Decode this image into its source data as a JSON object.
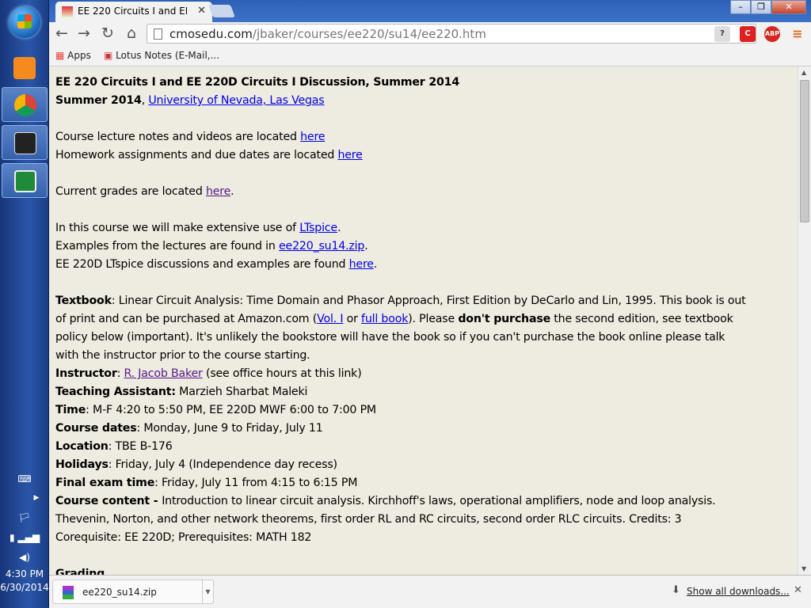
{
  "taskbar": {
    "time": "4:30 PM",
    "date": "6/30/2014"
  },
  "tab": {
    "title": "EE 220 Circuits I and EE 220D Circuits I Discussion, Summer 2014"
  },
  "toolbar": {
    "url_host": "cmosedu.com",
    "url_path": "/jbaker/courses/ee220/su14/ee220.htm",
    "ext_abp": "ABP"
  },
  "bookmarks": [
    {
      "label": "Apps"
    },
    {
      "label": "Lotus Notes (E-Mail,..."
    }
  ],
  "page": {
    "title": "EE 220 Circuits I and EE 220D Circuits I Discussion, Summer 2014",
    "term": "Summer 2014",
    "comma": ", ",
    "univ": "University of Nevada, Las Vegas",
    "lec": "Course lecture notes and videos are located ",
    "hw": "Homework assignments and due dates are located ",
    "grades": "Current grades are located ",
    "here": "here",
    "period": ".",
    "lt1": "In this course we will make extensive use of ",
    "ltspice": "LTspice",
    "ex1": "Examples from the lectures are found in ",
    "zip": "ee220_su14.zip",
    "ex2": "EE 220D LTspice discussions and examples are found ",
    "tb_label": "Textbook",
    "tb1": ": Linear Circuit Analysis: Time Domain and Phasor Approach, First Edition by DeCarlo and Lin, 1995. This book is out",
    "tb2": "of print and can be purchased at Amazon.com (",
    "vol1": "Vol. I",
    "or": " or ",
    "full": "full book",
    "tb3": "). Please ",
    "dont": "don't purchase",
    "tb4": " the second edition, see textbook",
    "tb5": "policy below (important). It's unlikely the bookstore will have the book so if you can't purchase the book online please talk",
    "tb6": "with the instructor prior to the course starting.",
    "instr_label": "Instructor",
    "colon": ": ",
    "instr": "R. Jacob Baker",
    "instr_note": " (see office hours at this link)",
    "ta_label": "Teaching Assistant:",
    "ta": " Marzieh Sharbat Maleki",
    "time_label": "Time",
    "time": ": M-F 4:20 to 5:50 PM, EE 220D MWF 6:00 to 7:00 PM",
    "dates_label": "Course dates",
    "dates": ": Monday, June 9 to Friday, July 11",
    "loc_label": "Location",
    "loc": ": TBE B-176",
    "hol_label": "Holidays",
    "hol": ": Friday, July 4 (Independence day recess)",
    "exam_label": "Final exam time",
    "exam": ": Friday, July 11 from 4:15 to 6:15 PM",
    "cc_label": "Course content - ",
    "cc1": "Introduction to linear circuit analysis. Kirchhoff's laws, operational amplifiers, node and loop analysis.",
    "cc2": "Thevenin, Norton, and other network theorems, first order RL and RC circuits, second order RLC circuits. Credits: 3",
    "cc3": "Corequisite: EE 220D; Prerequisites: MATH 182",
    "grading": "Grading"
  },
  "downloads": {
    "file": "ee220_su14.zip",
    "show_all": "Show all downloads..."
  }
}
